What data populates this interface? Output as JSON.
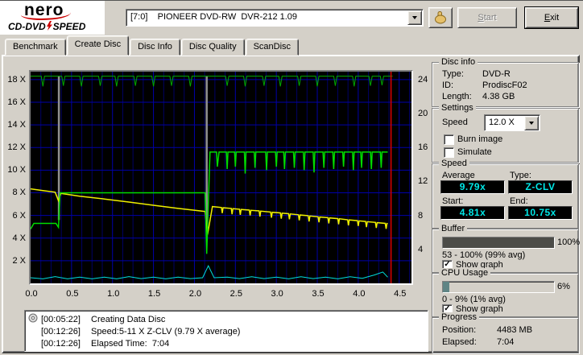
{
  "topbar": {
    "logo": {
      "brand": "nero",
      "product1": "CD-DVD",
      "product2": "SPEED"
    },
    "drive_select": {
      "value": "[7:0]    PIONEER DVD-RW  DVR-212 1.09"
    },
    "start_button": "Start",
    "exit_button": "Exit"
  },
  "tabs": [
    {
      "label": "Benchmark",
      "active": false
    },
    {
      "label": "Create Disc",
      "active": true
    },
    {
      "label": "Disc Info",
      "active": false
    },
    {
      "label": "Disc Quality",
      "active": false
    },
    {
      "label": "ScanDisc",
      "active": false
    }
  ],
  "chart_data": {
    "type": "line",
    "x_unit": "GB",
    "xlim": [
      0,
      4.65
    ],
    "ylim": [
      0,
      18.7
    ],
    "x_minor_step": 0.125,
    "bg": "#000000",
    "grid_color": "#0000aa",
    "minor_grid_color": "#000066",
    "x_ticks": [
      {
        "v": 0,
        "label": "0.0"
      },
      {
        "v": 0.5,
        "label": "0.5"
      },
      {
        "v": 1,
        "label": "1.0"
      },
      {
        "v": 1.5,
        "label": "1.5"
      },
      {
        "v": 2,
        "label": "2.0"
      },
      {
        "v": 2.5,
        "label": "2.5"
      },
      {
        "v": 3,
        "label": "3.0"
      },
      {
        "v": 3.5,
        "label": "3.5"
      },
      {
        "v": 4,
        "label": "4.0"
      },
      {
        "v": 4.5,
        "label": "4.5"
      }
    ],
    "left_axis_ticks": [
      {
        "v": 2,
        "label": "2 X"
      },
      {
        "v": 4,
        "label": "4 X"
      },
      {
        "v": 6,
        "label": "6 X"
      },
      {
        "v": 8,
        "label": "8 X"
      },
      {
        "v": 10,
        "label": "10 X"
      },
      {
        "v": 12,
        "label": "12 X"
      },
      {
        "v": 14,
        "label": "14 X"
      },
      {
        "v": 16,
        "label": "16 X"
      },
      {
        "v": 18,
        "label": "18 X"
      }
    ],
    "right_axis_ticks": [
      {
        "v": 3,
        "label": "4"
      },
      {
        "v": 6,
        "label": "8"
      },
      {
        "v": 9,
        "label": "12"
      },
      {
        "v": 12,
        "label": "16"
      },
      {
        "v": 15,
        "label": "20"
      },
      {
        "v": 18,
        "label": "24"
      }
    ],
    "series": [
      {
        "name": "buffer-dip-1",
        "color": "#909090",
        "width": 2.5,
        "points": [
          [
            0.345,
            18.3
          ],
          [
            0.345,
            5.6
          ]
        ]
      },
      {
        "name": "buffer-dip-2",
        "color": "#909090",
        "width": 2.5,
        "points": [
          [
            2.15,
            18.3
          ],
          [
            2.15,
            4.2
          ]
        ]
      },
      {
        "name": "buffer-level",
        "color": "#00aa00",
        "width": 1,
        "points": [
          [
            0,
            18.3
          ],
          [
            0.13,
            18.3
          ],
          [
            0.15,
            17.4
          ],
          [
            0.17,
            18.3
          ],
          [
            0.38,
            18.3
          ],
          [
            0.4,
            17.45
          ],
          [
            0.42,
            18.3
          ],
          [
            0.6,
            18.3
          ],
          [
            0.62,
            17.4
          ],
          [
            0.64,
            18.3
          ],
          [
            0.83,
            18.3
          ],
          [
            0.85,
            17.45
          ],
          [
            0.87,
            18.3
          ],
          [
            1.03,
            18.3
          ],
          [
            1.05,
            17.4
          ],
          [
            1.07,
            18.3
          ],
          [
            1.26,
            18.3
          ],
          [
            1.28,
            17.45
          ],
          [
            1.3,
            18.3
          ],
          [
            1.48,
            18.3
          ],
          [
            1.5,
            17.4
          ],
          [
            1.52,
            18.3
          ],
          [
            1.7,
            18.3
          ],
          [
            1.72,
            17.45
          ],
          [
            1.74,
            18.3
          ],
          [
            1.93,
            18.3
          ],
          [
            1.95,
            17.4
          ],
          [
            1.97,
            18.3
          ],
          [
            2.38,
            18.3
          ],
          [
            2.4,
            17.45
          ],
          [
            2.42,
            18.3
          ],
          [
            2.6,
            18.3
          ],
          [
            2.62,
            17.4
          ],
          [
            2.64,
            18.3
          ],
          [
            2.83,
            18.3
          ],
          [
            2.85,
            17.45
          ],
          [
            2.87,
            18.3
          ],
          [
            3.03,
            18.3
          ],
          [
            3.05,
            17.4
          ],
          [
            3.07,
            18.3
          ],
          [
            3.26,
            18.3
          ],
          [
            3.28,
            17.45
          ],
          [
            3.3,
            18.3
          ],
          [
            3.48,
            18.3
          ],
          [
            3.5,
            17.4
          ],
          [
            3.52,
            18.3
          ],
          [
            3.7,
            18.3
          ],
          [
            3.72,
            17.45
          ],
          [
            3.74,
            18.3
          ],
          [
            3.93,
            18.3
          ],
          [
            3.95,
            17.4
          ],
          [
            3.97,
            18.3
          ],
          [
            4.13,
            18.3
          ],
          [
            4.15,
            17.45
          ],
          [
            4.17,
            18.3
          ],
          [
            4.27,
            18.3
          ],
          [
            4.29,
            17.5
          ],
          [
            4.31,
            18.3
          ],
          [
            4.42,
            18.3
          ]
        ]
      },
      {
        "name": "rotation-speed",
        "color": "#f0f000",
        "width": 1.5,
        "points": [
          [
            0,
            8.35
          ],
          [
            0.15,
            8.2
          ],
          [
            0.3,
            8.05
          ],
          [
            0.34,
            7.3
          ],
          [
            0.37,
            7.95
          ],
          [
            0.6,
            7.7
          ],
          [
            0.9,
            7.45
          ],
          [
            1.2,
            7.18
          ],
          [
            1.5,
            6.9
          ],
          [
            1.8,
            6.62
          ],
          [
            2.05,
            6.42
          ],
          [
            2.13,
            6.35
          ],
          [
            2.16,
            4.3
          ],
          [
            2.22,
            6.78
          ],
          [
            2.33,
            6.7
          ],
          [
            2.34,
            6.2
          ],
          [
            2.35,
            6.68
          ],
          [
            2.45,
            6.62
          ],
          [
            2.46,
            6.1
          ],
          [
            2.47,
            6.6
          ],
          [
            2.55,
            6.55
          ],
          [
            2.56,
            6.05
          ],
          [
            2.57,
            6.53
          ],
          [
            2.67,
            6.47
          ],
          [
            2.68,
            6
          ],
          [
            2.69,
            6.45
          ],
          [
            2.79,
            6.4
          ],
          [
            2.8,
            5.9
          ],
          [
            2.81,
            6.38
          ],
          [
            2.93,
            6.3
          ],
          [
            2.94,
            5.8
          ],
          [
            2.95,
            6.28
          ],
          [
            3.05,
            6.22
          ],
          [
            3.06,
            5.72
          ],
          [
            3.07,
            6.2
          ],
          [
            3.15,
            6.15
          ],
          [
            3.16,
            5.66
          ],
          [
            3.17,
            6.13
          ],
          [
            3.27,
            6.06
          ],
          [
            3.28,
            5.57
          ],
          [
            3.29,
            6.04
          ],
          [
            3.39,
            5.97
          ],
          [
            3.4,
            5.47
          ],
          [
            3.41,
            5.95
          ],
          [
            3.51,
            5.88
          ],
          [
            3.52,
            5.4
          ],
          [
            3.53,
            5.86
          ],
          [
            3.63,
            5.8
          ],
          [
            3.64,
            5.3
          ],
          [
            3.65,
            5.78
          ],
          [
            3.75,
            5.72
          ],
          [
            3.76,
            5.22
          ],
          [
            3.77,
            5.7
          ],
          [
            3.87,
            5.62
          ],
          [
            3.88,
            5.12
          ],
          [
            3.89,
            5.6
          ],
          [
            3.99,
            5.54
          ],
          [
            4,
            5.06
          ],
          [
            4.01,
            5.52
          ],
          [
            4.09,
            5.47
          ],
          [
            4.1,
            4.97
          ],
          [
            4.11,
            5.45
          ],
          [
            4.21,
            5.38
          ],
          [
            4.22,
            4.9
          ],
          [
            4.23,
            5.36
          ],
          [
            4.33,
            5.3
          ],
          [
            4.34,
            4.82
          ],
          [
            4.35,
            5.28
          ],
          [
            4.36,
            5.27
          ]
        ]
      },
      {
        "name": "write-speed",
        "color": "#00dc00",
        "width": 1.5,
        "points": [
          [
            0,
            4.8
          ],
          [
            0.04,
            5.3
          ],
          [
            0.31,
            5.3
          ],
          [
            0.34,
            4.95
          ],
          [
            0.36,
            8
          ],
          [
            2.13,
            8
          ],
          [
            2.15,
            2.6
          ],
          [
            2.19,
            11.6
          ],
          [
            2.27,
            11.6
          ],
          [
            2.28,
            10.3
          ],
          [
            2.3,
            11.6
          ],
          [
            2.39,
            11.6
          ],
          [
            2.4,
            10.1
          ],
          [
            2.41,
            11.6
          ],
          [
            2.49,
            11.6
          ],
          [
            2.5,
            10.3
          ],
          [
            2.51,
            11.6
          ],
          [
            2.61,
            11.6
          ],
          [
            2.62,
            9.7
          ],
          [
            2.63,
            11.6
          ],
          [
            2.73,
            11.6
          ],
          [
            2.74,
            10.2
          ],
          [
            2.75,
            11.6
          ],
          [
            2.87,
            11.6
          ],
          [
            2.88,
            10
          ],
          [
            2.89,
            11.6
          ],
          [
            2.99,
            11.6
          ],
          [
            3,
            10.3
          ],
          [
            3.01,
            11.6
          ],
          [
            3.09,
            11.6
          ],
          [
            3.1,
            10.1
          ],
          [
            3.11,
            11.6
          ],
          [
            3.21,
            11.6
          ],
          [
            3.22,
            10.2
          ],
          [
            3.23,
            11.6
          ],
          [
            3.33,
            11.6
          ],
          [
            3.34,
            10
          ],
          [
            3.35,
            11.6
          ],
          [
            3.45,
            11.6
          ],
          [
            3.46,
            9.8
          ],
          [
            3.47,
            11.6
          ],
          [
            3.57,
            11.6
          ],
          [
            3.58,
            10.2
          ],
          [
            3.59,
            11.6
          ],
          [
            3.69,
            11.6
          ],
          [
            3.7,
            10.1
          ],
          [
            3.71,
            11.6
          ],
          [
            3.81,
            11.6
          ],
          [
            3.82,
            10.3
          ],
          [
            3.83,
            11.6
          ],
          [
            3.93,
            11.6
          ],
          [
            3.94,
            10
          ],
          [
            3.95,
            11.6
          ],
          [
            4.03,
            11.6
          ],
          [
            4.04,
            10.2
          ],
          [
            4.05,
            11.6
          ],
          [
            4.15,
            11.6
          ],
          [
            4.16,
            10.1
          ],
          [
            4.17,
            11.6
          ],
          [
            4.27,
            11.6
          ],
          [
            4.28,
            10.2
          ],
          [
            4.29,
            11.6
          ],
          [
            4.36,
            11.6
          ]
        ]
      },
      {
        "name": "cpu-usage",
        "color": "#00e0e0",
        "width": 1,
        "points": [
          [
            0,
            0.5
          ],
          [
            0.15,
            0.4
          ],
          [
            0.3,
            0.6
          ],
          [
            0.45,
            0.4
          ],
          [
            0.6,
            0.55
          ],
          [
            0.75,
            0.4
          ],
          [
            0.9,
            0.55
          ],
          [
            1.05,
            0.4
          ],
          [
            1.2,
            0.6
          ],
          [
            1.35,
            0.42
          ],
          [
            1.5,
            0.55
          ],
          [
            1.65,
            0.4
          ],
          [
            1.8,
            0.55
          ],
          [
            1.95,
            0.42
          ],
          [
            2.1,
            0.5
          ],
          [
            2.17,
            1.55
          ],
          [
            2.24,
            0.5
          ],
          [
            2.4,
            0.55
          ],
          [
            2.55,
            0.42
          ],
          [
            2.7,
            0.58
          ],
          [
            2.85,
            0.42
          ],
          [
            3,
            0.55
          ],
          [
            3.15,
            0.4
          ],
          [
            3.3,
            0.58
          ],
          [
            3.45,
            0.42
          ],
          [
            3.6,
            0.55
          ],
          [
            3.75,
            0.4
          ],
          [
            3.9,
            0.58
          ],
          [
            4.05,
            0.45
          ],
          [
            4.2,
            0.75
          ],
          [
            4.3,
            1
          ],
          [
            4.36,
            0.55
          ]
        ]
      },
      {
        "name": "position-marker",
        "color": "#e00000",
        "width": 1.5,
        "points": [
          [
            4.4,
            0
          ],
          [
            4.4,
            18.7
          ]
        ]
      }
    ]
  },
  "panels": {
    "disc_info": {
      "title": "Disc info",
      "rows": [
        [
          "Type:",
          "DVD-R"
        ],
        [
          "ID:",
          "ProdiscF02"
        ],
        [
          "Length:",
          "4.38 GB"
        ]
      ]
    },
    "settings": {
      "title": "Settings",
      "speed_label": "Speed",
      "speed_value": "12.0 X",
      "checkboxes": [
        {
          "label": "Burn image",
          "checked": false,
          "mark": ""
        },
        {
          "label": "Simulate",
          "checked": false,
          "mark": ""
        }
      ]
    },
    "speed": {
      "title": "Speed",
      "average_label": "Average",
      "average_value": "9.79x",
      "type_label": "Type:",
      "type_value": "Z-CLV",
      "start_label": "Start:",
      "start_value": "4.81x",
      "end_label": "End:",
      "end_value": "10.75x"
    },
    "buffer": {
      "title": "Buffer",
      "percent": "100%",
      "fill_percent": 100,
      "range_text": "53 - 100% (99% avg)",
      "show_graph": {
        "label": "Show graph",
        "checked": true,
        "mark": "✓"
      }
    },
    "cpu": {
      "title": "CPU Usage",
      "percent": "6%",
      "fill_percent": 6,
      "range_text": "0 - 9% (1% avg)",
      "show_graph": {
        "label": "Show graph",
        "checked": true,
        "mark": "✓"
      }
    },
    "progress": {
      "title": "Progress",
      "rows": [
        [
          "Position:",
          "4483 MB"
        ],
        [
          "Elapsed:",
          "7:04"
        ]
      ]
    }
  },
  "log": {
    "lines": [
      {
        "time": "[00:05:22]",
        "text": "Creating Data Disc"
      },
      {
        "time": "[00:12:26]",
        "text": "Speed:5-11 X Z-CLV (9.79 X average)"
      },
      {
        "time": "[00:12:26]",
        "text": "Elapsed Time:  7:04"
      }
    ]
  }
}
